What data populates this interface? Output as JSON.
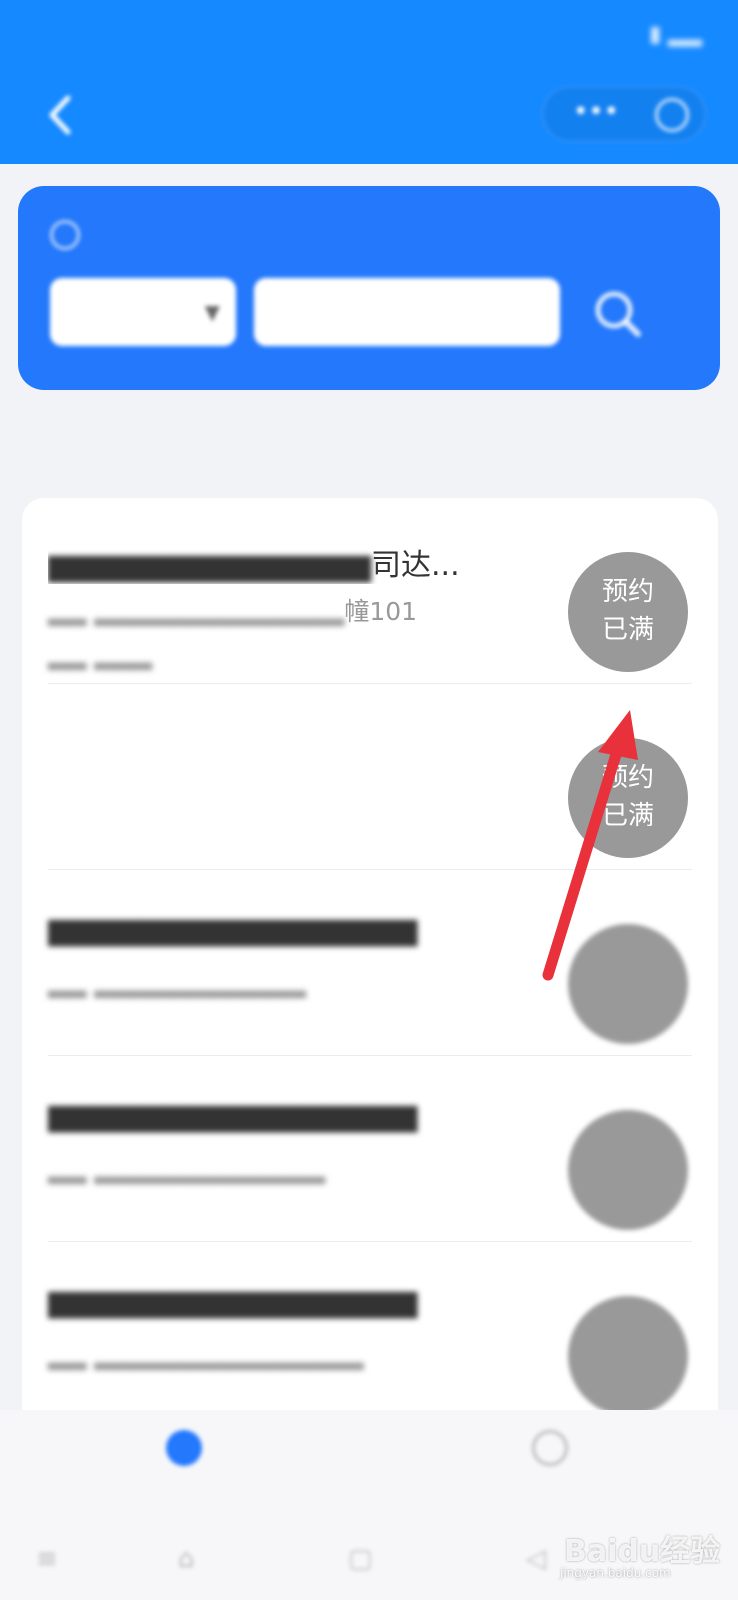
{
  "status_bar": {
    "time": "",
    "right": ""
  },
  "header": {
    "title": ""
  },
  "search": {
    "city": "",
    "placeholder": "",
    "notice": ""
  },
  "section_title": "",
  "list": [
    {
      "title_visible": "司达...",
      "addr_visible": "幢101",
      "badge_line1": "预约",
      "badge_line2": "已满"
    },
    {
      "title_visible": "",
      "addr_visible": "",
      "badge_line1": "预约",
      "badge_line2": "已满"
    },
    {
      "title_visible": "",
      "addr_visible": "",
      "badge_line1": "",
      "badge_line2": ""
    },
    {
      "title_visible": "",
      "addr_visible": "",
      "badge_line1": "",
      "badge_line2": ""
    },
    {
      "title_visible": "",
      "addr_visible": "",
      "badge_line1": "",
      "badge_line2": ""
    }
  ],
  "tabs": [
    {
      "label": "",
      "color": "#2378fb",
      "icon": "home-icon"
    },
    {
      "label": "",
      "color": "#bbbbbb",
      "icon": "user-icon"
    }
  ],
  "watermark": {
    "text": "Baidu经验",
    "url": "jingyan.baidu.com"
  },
  "colors": {
    "header_blue": "#1589ff",
    "card_blue": "#2378fb",
    "notice_green": "#c9f03b",
    "badge_gray": "#999999",
    "annotation_red": "#e8313a"
  }
}
